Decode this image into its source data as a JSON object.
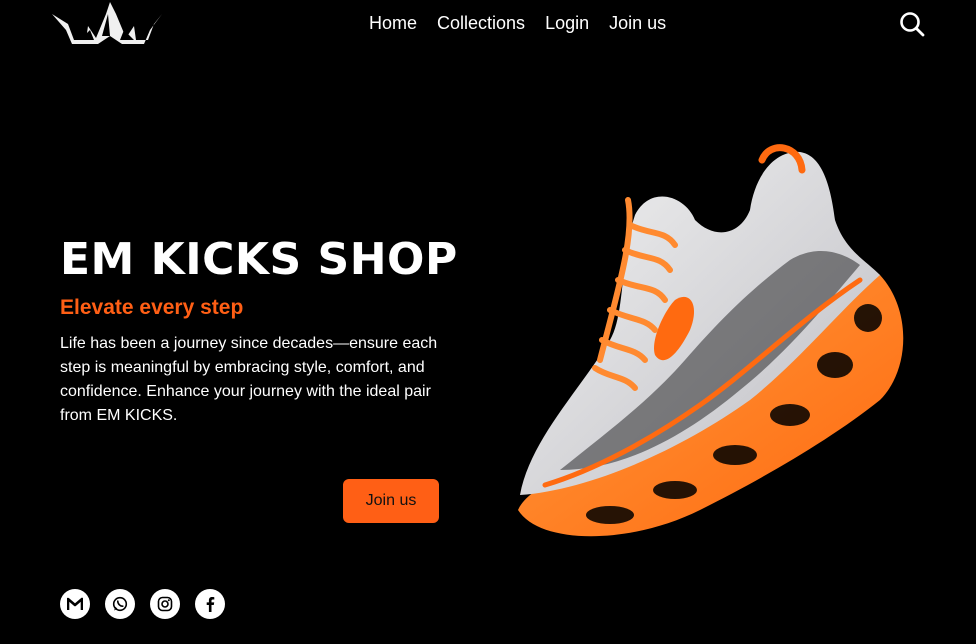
{
  "nav": {
    "items": [
      {
        "label": "Home"
      },
      {
        "label": "Collections"
      },
      {
        "label": "Login"
      },
      {
        "label": "Join us"
      }
    ]
  },
  "hero": {
    "title": "EM KICKS SHOP",
    "subtitle": "Elevate every step",
    "description": "Life has been a journey since decades—ensure each step is meaningful by embracing style, comfort, and confidence. Enhance your journey with the ideal pair from EM KICKS.",
    "cta_label": "Join us"
  },
  "social": [
    "gmail-icon",
    "whatsapp-icon",
    "instagram-icon",
    "facebook-icon"
  ],
  "colors": {
    "accent": "#ff5f15",
    "background": "#000000",
    "text": "#ffffff"
  }
}
